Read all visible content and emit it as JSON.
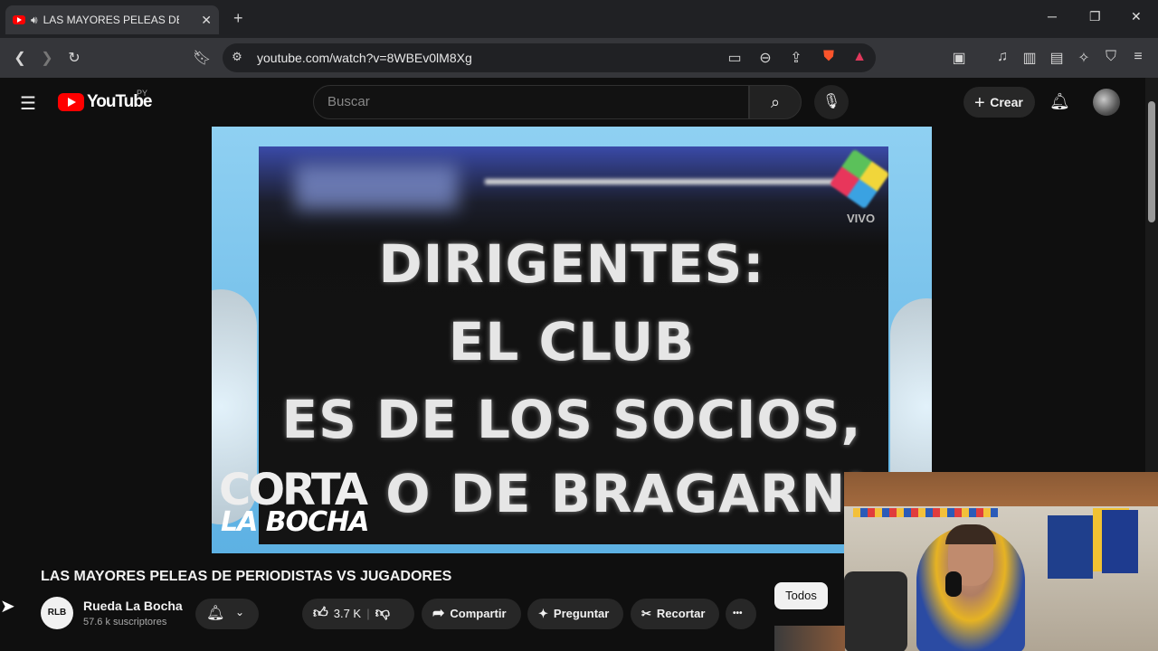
{
  "browser": {
    "tab_title": "LAS MAYORES PELEAS DE PER",
    "new_tab": "+",
    "close_tab": "✕",
    "url": "youtube.com/watch?v=8WBEv0lM8Xg",
    "window": {
      "minimize": "─",
      "restore": "❐",
      "close": "✕"
    }
  },
  "youtube": {
    "logo_text": "YouTube",
    "region": "PY",
    "search_placeholder": "Buscar",
    "create_label": "Crear"
  },
  "video": {
    "overlay_lines": [
      "DIRIGENTES:",
      "EL CLUB",
      "ES DE LOS SOCIOS,",
      "O DE BRAGARNI"
    ],
    "live_tag": "VIVO",
    "brand_top": "CORTA",
    "brand_bottom": "LA BOCHA",
    "title": "LAS MAYORES PELEAS DE PERIODISTAS VS JUGADORES"
  },
  "channel": {
    "avatar_text": "RLB",
    "name": "Rueda La Bocha",
    "subscribers": "57.6 k suscriptores"
  },
  "actions": {
    "likes": "3.7 K",
    "share": "Compartir",
    "ask": "Preguntar",
    "clip": "Recortar",
    "more": "•••"
  },
  "filter_chip": "Todos",
  "icons": [
    "speaker-icon",
    "back-icon",
    "forward-icon",
    "reload-icon",
    "bookmark-icon",
    "site-info-icon",
    "cast-icon",
    "zoom-icon",
    "share-icon",
    "brave-shield-icon",
    "rewards-icon",
    "reader-icon",
    "music-icon",
    "sidebar-icon",
    "wallet-icon",
    "leo-icon",
    "vpn-icon",
    "menu-icon",
    "search-icon",
    "mic-icon",
    "bell-icon",
    "like-icon",
    "dislike-icon",
    "clip-icon"
  ]
}
